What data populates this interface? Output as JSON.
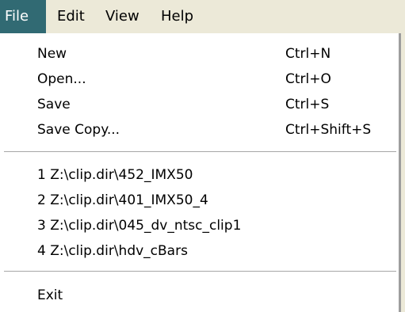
{
  "menubar": {
    "items": [
      {
        "label": "File",
        "active": true
      },
      {
        "label": "Edit"
      },
      {
        "label": "View"
      },
      {
        "label": "Help"
      }
    ]
  },
  "file_menu": {
    "commands": [
      {
        "label": "New",
        "shortcut": "Ctrl+N"
      },
      {
        "label": "Open...",
        "shortcut": "Ctrl+O"
      },
      {
        "label": "Save",
        "shortcut": "Ctrl+S"
      },
      {
        "label": "Save Copy...",
        "shortcut": "Ctrl+Shift+S"
      }
    ],
    "recent_files": [
      {
        "label": "1 Z:\\clip.dir\\452_IMX50"
      },
      {
        "label": "2 Z:\\clip.dir\\401_IMX50_4"
      },
      {
        "label": "3 Z:\\clip.dir\\045_dv_ntsc_clip1"
      },
      {
        "label": "4 Z:\\clip.dir\\hdv_cBars"
      }
    ],
    "exit": {
      "label": "Exit"
    }
  },
  "colors": {
    "menu_background": "#ece9d8",
    "dropdown_background": "#ffffff",
    "active_highlight": "#316a73"
  }
}
